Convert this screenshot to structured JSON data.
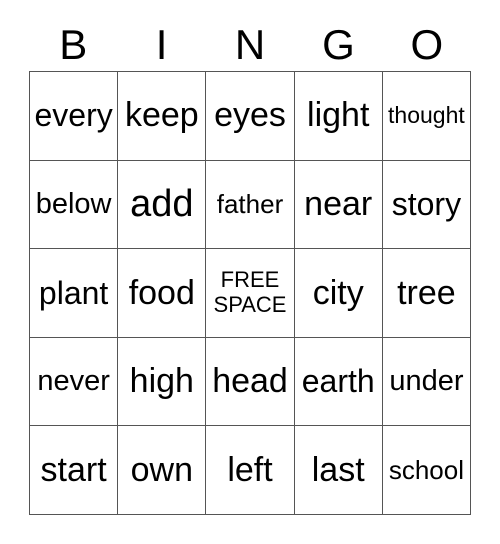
{
  "card": {
    "header_letters": [
      "B",
      "I",
      "N",
      "G",
      "O"
    ],
    "rows": [
      [
        {
          "text": "every",
          "size": "fs-md"
        },
        {
          "text": "keep",
          "size": "fs-lg"
        },
        {
          "text": "eyes",
          "size": "fs-lg"
        },
        {
          "text": "light",
          "size": "fs-lg"
        },
        {
          "text": "thought",
          "size": "fs-xxs"
        }
      ],
      [
        {
          "text": "below",
          "size": "fs-sm"
        },
        {
          "text": "add",
          "size": "fs-xl"
        },
        {
          "text": "father",
          "size": "fs-xs"
        },
        {
          "text": "near",
          "size": "fs-lg"
        },
        {
          "text": "story",
          "size": "fs-md"
        }
      ],
      [
        {
          "text": "plant",
          "size": "fs-md"
        },
        {
          "text": "food",
          "size": "fs-lg"
        },
        {
          "text": "FREE\nSPACE",
          "size": "fs-free",
          "free": true
        },
        {
          "text": "city",
          "size": "fs-lg"
        },
        {
          "text": "tree",
          "size": "fs-lg"
        }
      ],
      [
        {
          "text": "never",
          "size": "fs-sm"
        },
        {
          "text": "high",
          "size": "fs-lg"
        },
        {
          "text": "head",
          "size": "fs-lg"
        },
        {
          "text": "earth",
          "size": "fs-md"
        },
        {
          "text": "under",
          "size": "fs-sm"
        }
      ],
      [
        {
          "text": "start",
          "size": "fs-lg"
        },
        {
          "text": "own",
          "size": "fs-lg"
        },
        {
          "text": "left",
          "size": "fs-lg"
        },
        {
          "text": "last",
          "size": "fs-lg"
        },
        {
          "text": "school",
          "size": "fs-xs"
        }
      ]
    ],
    "colors": {
      "text": "#000000",
      "grid_line": "#555555",
      "background": "#ffffff"
    }
  }
}
